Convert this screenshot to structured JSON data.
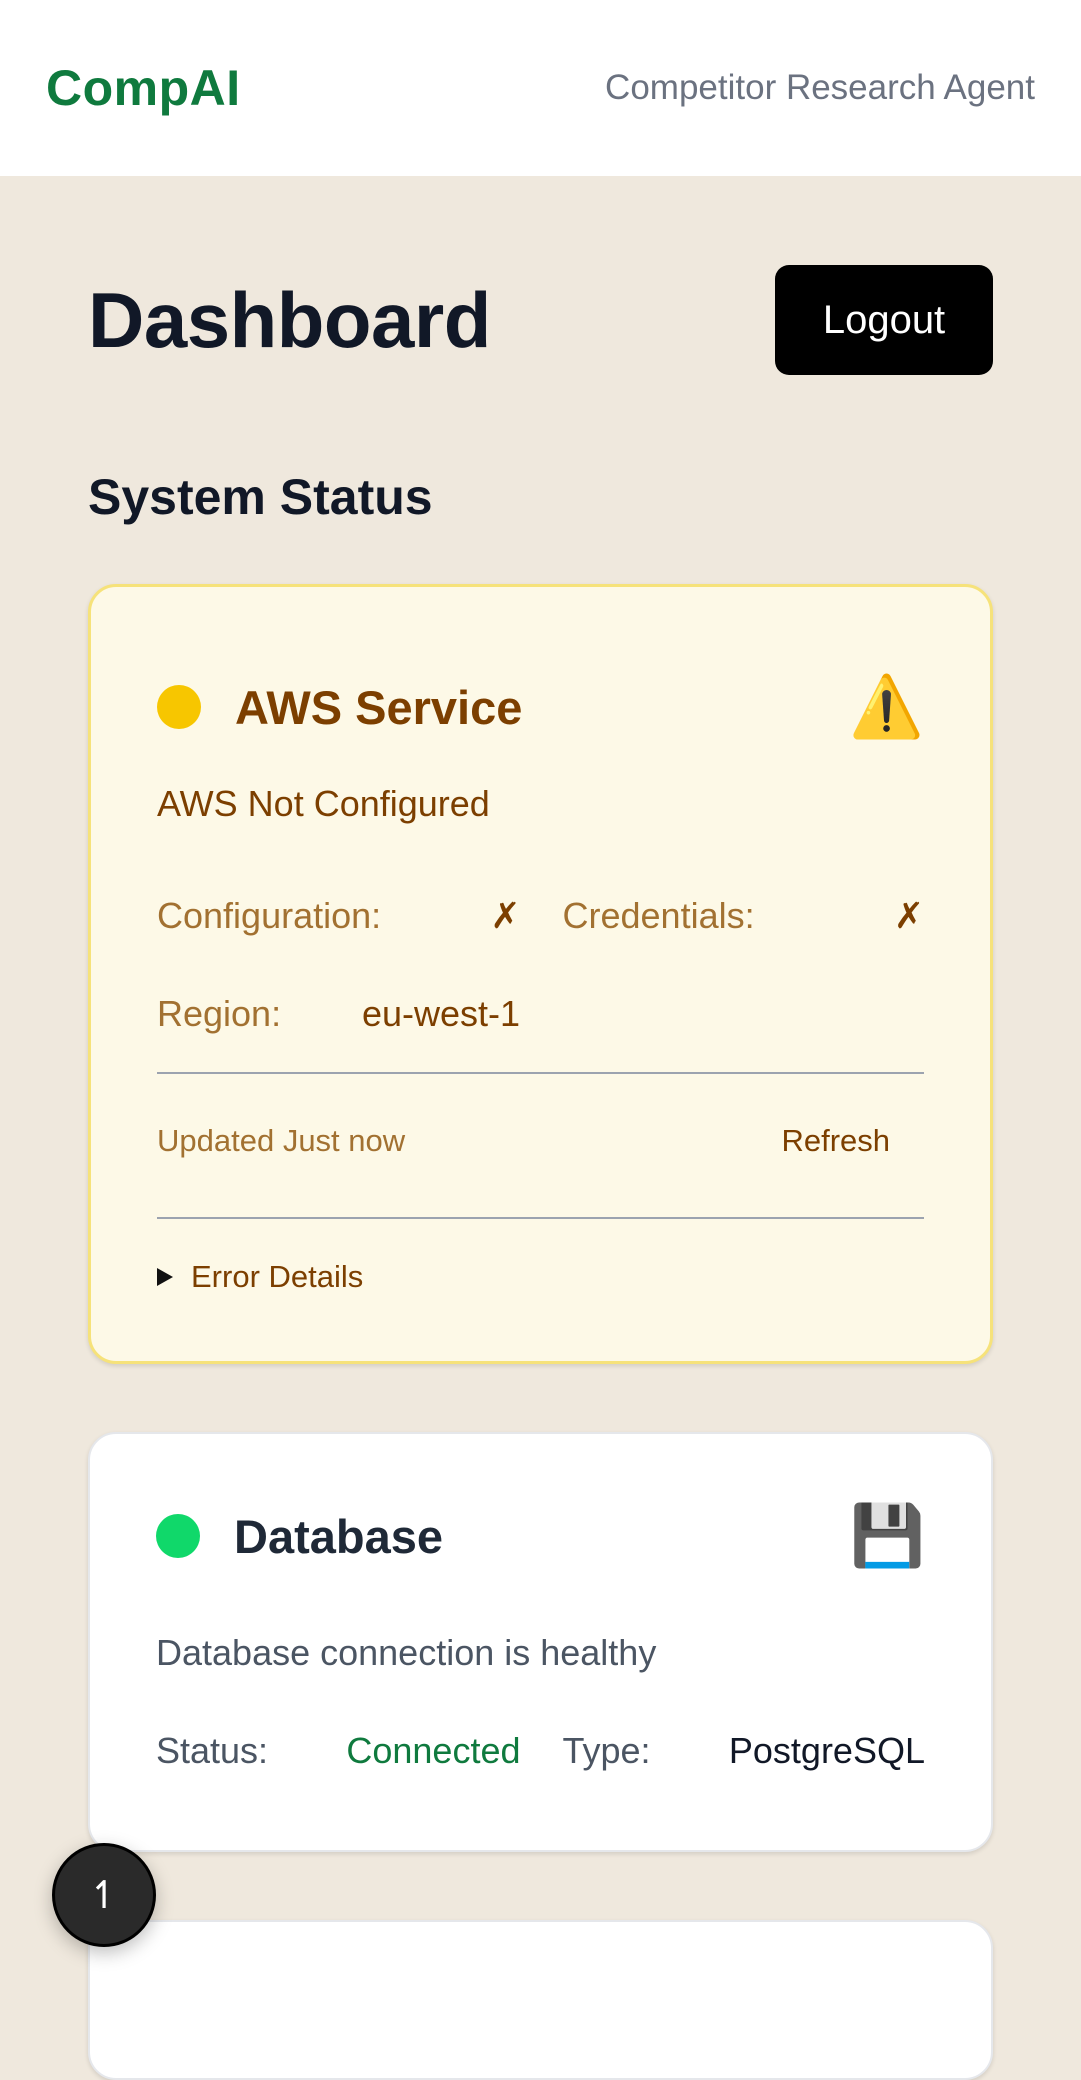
{
  "topbar": {
    "brand": "CompAI",
    "subtitle": "Competitor Research Agent"
  },
  "page": {
    "title": "Dashboard",
    "logout_label": "Logout",
    "section_title": "System Status"
  },
  "aws_card": {
    "name": "AWS Service",
    "status_color": "#f7c600",
    "icon": "warning-icon",
    "icon_glyph": "⚠️",
    "message": "AWS Not Configured",
    "configuration_label": "Configuration:",
    "configuration_value": "✗",
    "credentials_label": "Credentials:",
    "credentials_value": "✗",
    "region_label": "Region:",
    "region_value": "eu-west-1",
    "updated_text": "Updated Just now",
    "refresh_label": "Refresh",
    "error_details_label": "Error Details"
  },
  "database_card": {
    "name": "Database",
    "status_color": "#10d86a",
    "icon": "floppy-disk-icon",
    "icon_glyph": "💾",
    "message": "Database connection is healthy",
    "status_label": "Status:",
    "status_value": "Connected",
    "type_label": "Type:",
    "type_value": "PostgreSQL"
  },
  "scroll_button": {
    "icon": "arrow-up-icon",
    "glyph": "↿"
  }
}
